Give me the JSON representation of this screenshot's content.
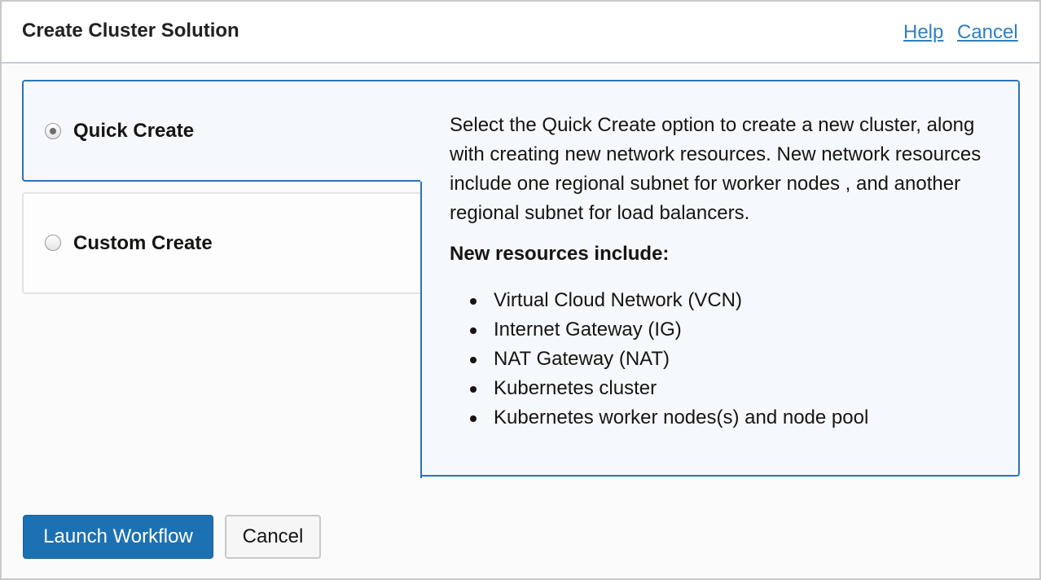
{
  "header": {
    "title": "Create Cluster Solution",
    "help_link": "Help",
    "cancel_link": "Cancel"
  },
  "options": [
    {
      "label": "Quick Create",
      "selected": true
    },
    {
      "label": "Custom Create",
      "selected": false
    }
  ],
  "info": {
    "description": "Select the Quick Create option to create a new cluster, along with creating new network resources. New network resources include one regional subnet for worker nodes , and another regional subnet for load balancers.",
    "subheading": "New resources include:",
    "resources": [
      "Virtual Cloud Network (VCN)",
      "Internet Gateway (IG)",
      "NAT Gateway (NAT)",
      "Kubernetes cluster",
      "Kubernetes worker nodes(s) and node pool"
    ]
  },
  "footer": {
    "launch_label": "Launch Workflow",
    "cancel_label": "Cancel"
  },
  "colors": {
    "accent": "#2b74b8",
    "primary_button": "#1c71b3",
    "link": "#2f7fc0"
  }
}
